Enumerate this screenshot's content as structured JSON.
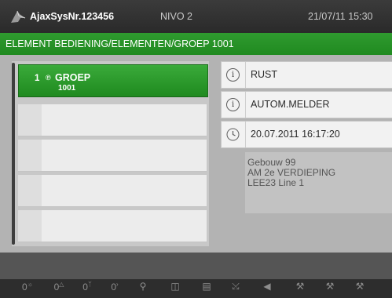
{
  "header": {
    "logo_icon": "ajax-logo-icon",
    "system_name": "AjaxSysNr.123456",
    "level": "NIVO 2",
    "datetime": "21/07/11 15:30"
  },
  "breadcrumb": "ELEMENT BEDIENING/ELEMENTEN/GROEP 1001",
  "groups": [
    {
      "number": "1",
      "name": "GROEP",
      "code": "1001",
      "icon": "bell-icon",
      "selected": true
    },
    {
      "number": "",
      "name": "",
      "code": ""
    },
    {
      "number": "",
      "name": "",
      "code": ""
    },
    {
      "number": "",
      "name": "",
      "code": ""
    },
    {
      "number": "",
      "name": "",
      "code": ""
    }
  ],
  "details": {
    "status": {
      "icon": "info-icon",
      "text": "RUST"
    },
    "type": {
      "icon": "info-icon",
      "text": "AUTOM.MELDER"
    },
    "time": {
      "icon": "clock-icon",
      "text": "20.07.2011 16:17:20"
    },
    "location_lines": [
      "Gebouw 99",
      "AM 2e VERDIEPING",
      "LEE23 Line 1"
    ]
  },
  "toolbar_icons": [
    "zero-sun-icon",
    "zero-triangle-icon",
    "zero-person-icon",
    "zero-flag-icon",
    "crossed-bell-icon",
    "crossed-siren-icon",
    "box-icon",
    "connector-icon",
    "speaker-icon",
    "tool-icon",
    "tool-icon",
    "tool-icon"
  ],
  "colors": {
    "accent_green": "#2a942a",
    "topbar": "#333333",
    "panel": "#b3b3b3"
  }
}
